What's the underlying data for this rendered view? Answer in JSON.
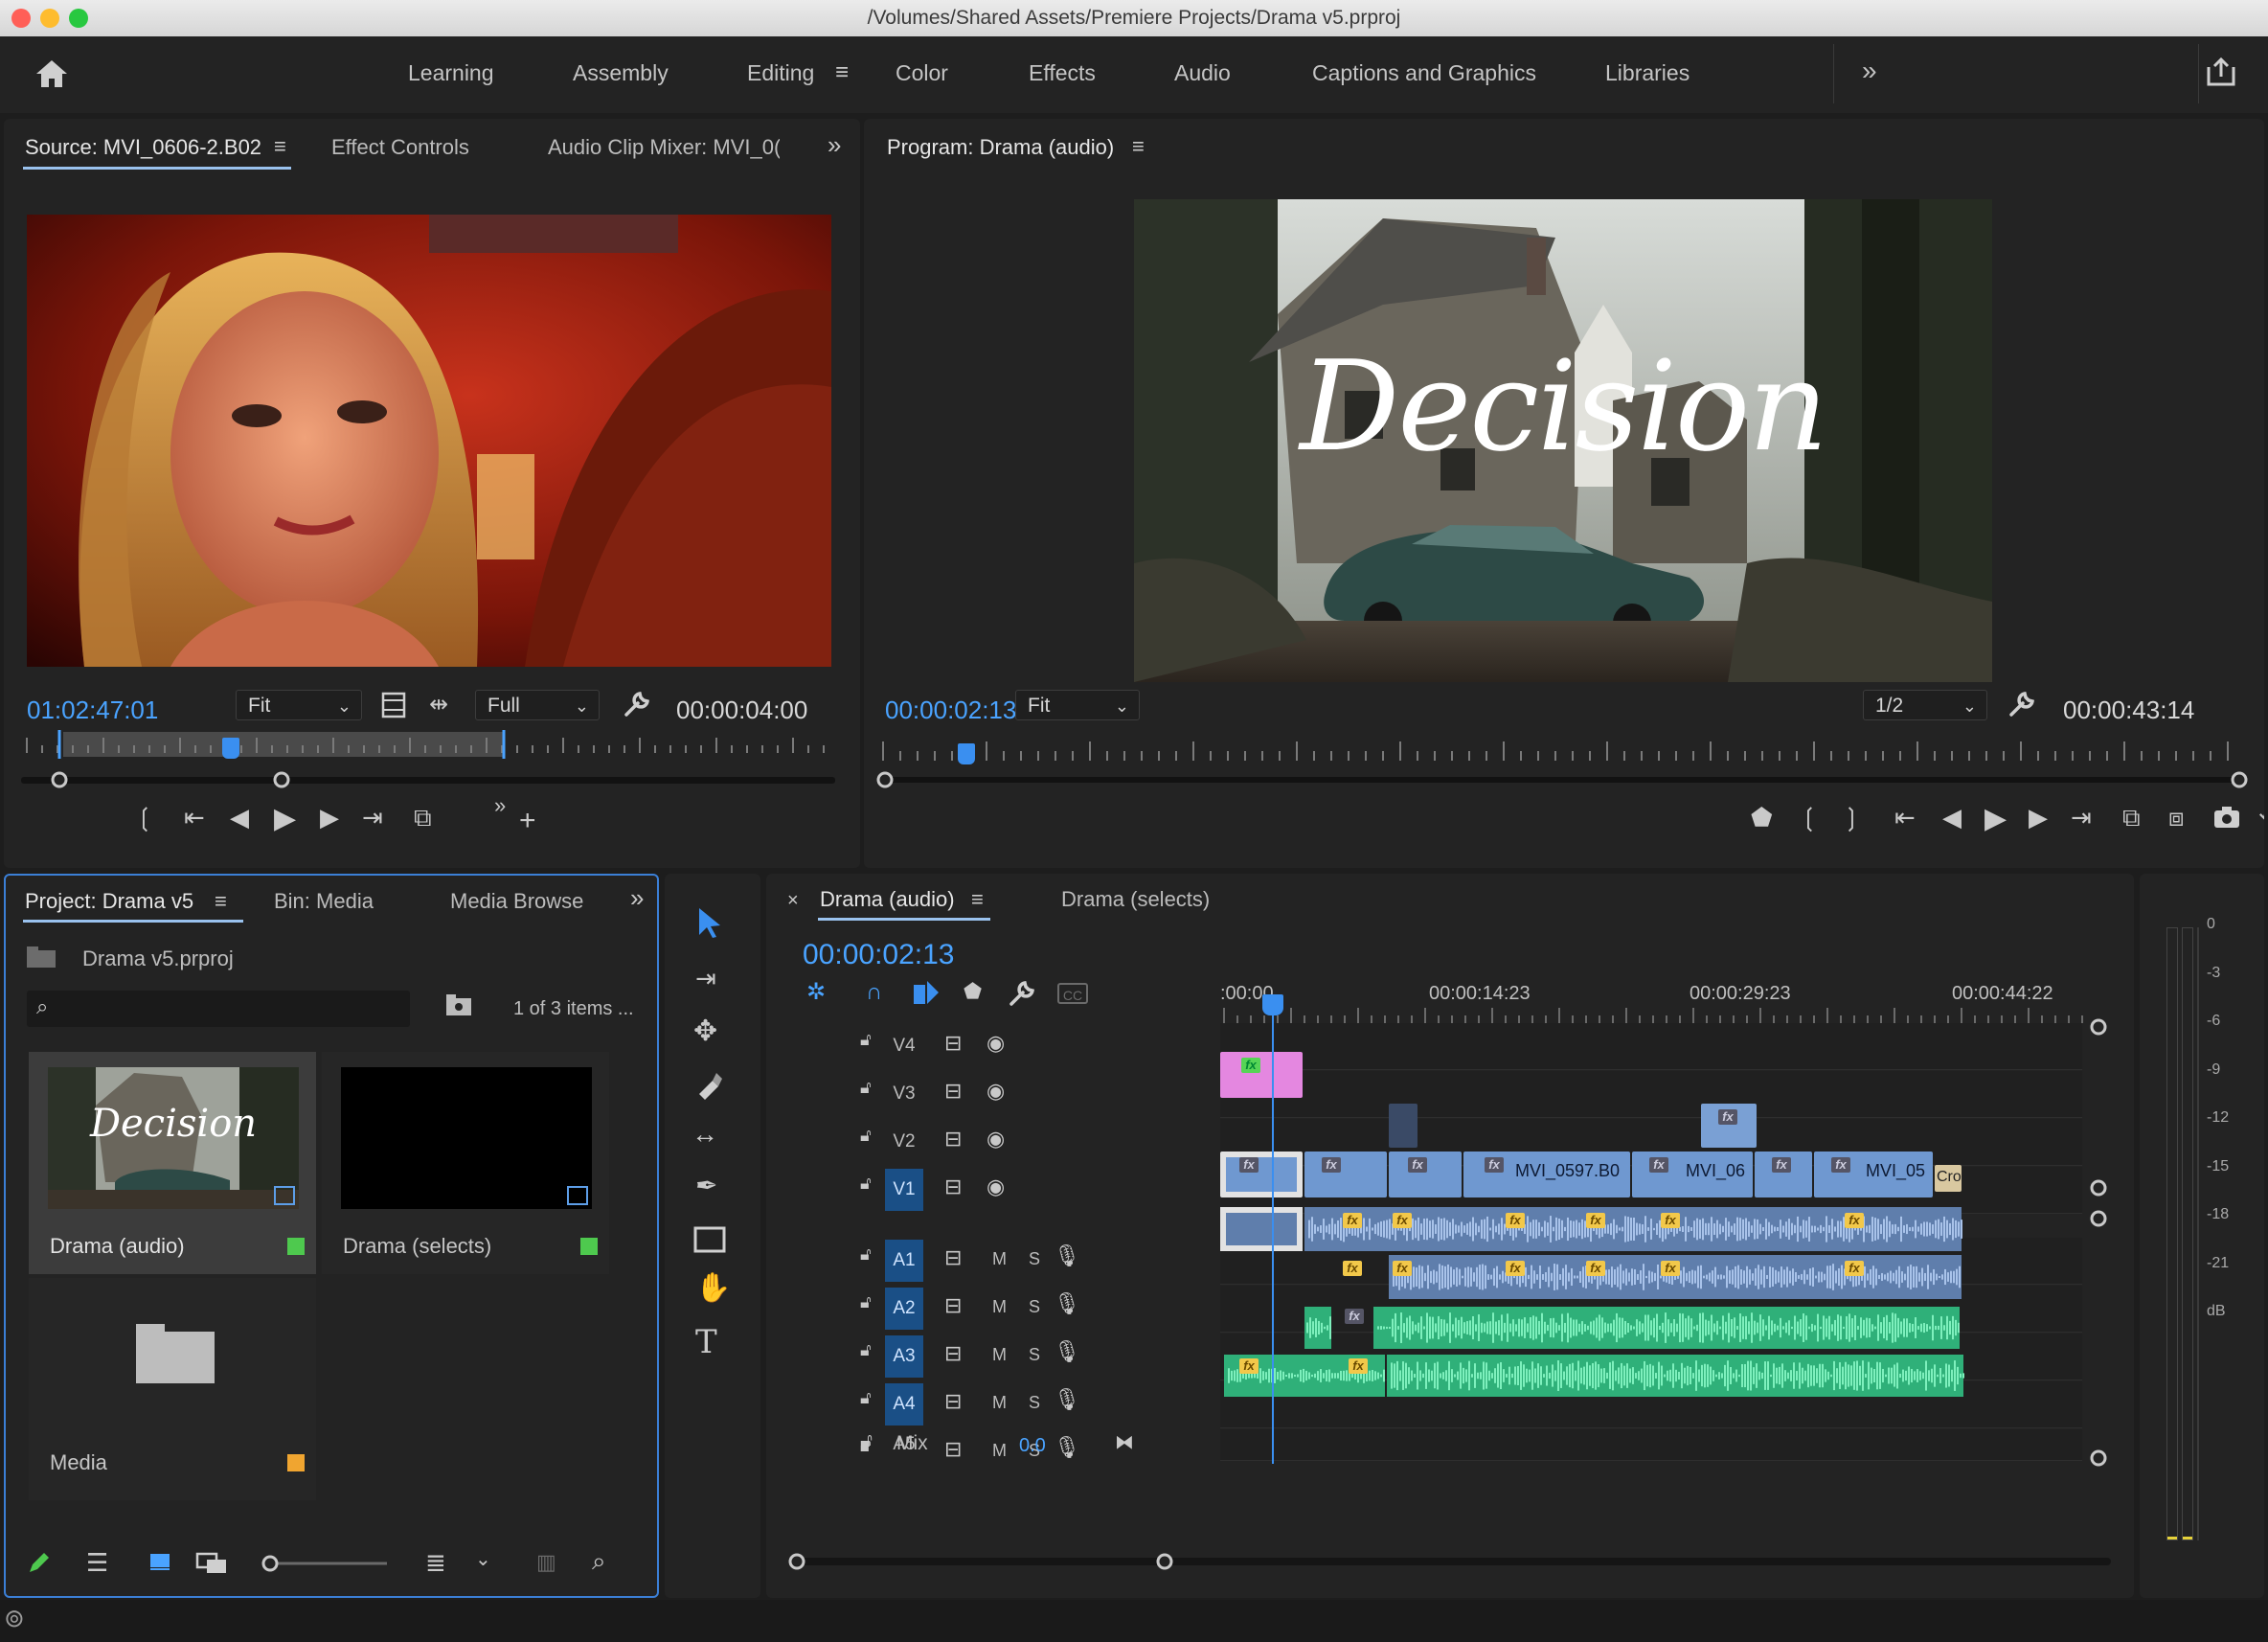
{
  "window": {
    "title": "/Volumes/Shared Assets/Premiere Projects/Drama v5.prproj"
  },
  "workspaces": {
    "items": [
      "Learning",
      "Assembly",
      "Editing",
      "Color",
      "Effects",
      "Audio",
      "Captions and Graphics",
      "Libraries"
    ],
    "active": "Editing",
    "overflow": "»"
  },
  "source_panel": {
    "tabs": [
      "Source: MVI_0606-2.B02",
      "Effect Controls",
      "Audio Clip Mixer: MVI_0("
    ],
    "timecode": "01:02:47:01",
    "zoom": "Fit",
    "resolution": "Full",
    "duration": "00:00:04:00",
    "playhead_fraction": 0.38
  },
  "program_panel": {
    "title": "Program: Drama (audio)",
    "timecode": "00:00:02:13",
    "zoom": "Fit",
    "resolution": "1/2",
    "duration": "00:00:43:14",
    "title_overlay": "Decision",
    "playhead_fraction": 0.06
  },
  "project_panel": {
    "tabs": [
      "Project: Drama v5",
      "Bin: Media",
      "Media Browse"
    ],
    "file": "Drama v5.prproj",
    "count": "1 of 3 items ...",
    "items": [
      {
        "name": "Drama (audio)",
        "color": "#4ec94e",
        "thumb_text": "Decision"
      },
      {
        "name": "Drama (selects)",
        "color": "#4ec94e"
      },
      {
        "name": "Media",
        "color": "#f0a530"
      }
    ]
  },
  "timeline": {
    "tabs": [
      "Drama (audio)",
      "Drama (selects)"
    ],
    "timecode": "00:00:02:13",
    "ruler": [
      ":00:00",
      "00:00:14:23",
      "00:00:29:23",
      "00:00:44:22"
    ],
    "video_tracks": [
      "V4",
      "V3",
      "V2",
      "V1"
    ],
    "audio_tracks": [
      "A1",
      "A2",
      "A3",
      "A4",
      "A5"
    ],
    "mute_label": "M",
    "solo_label": "S",
    "mix_label": "Mix",
    "mix_value": "0.0",
    "clips": {
      "v1_a": "MVI_0597.B0",
      "v1_b": "MVI_06",
      "v1_c": "MVI_05",
      "v1_d": "Cro"
    },
    "fx_label": "fx"
  },
  "meters": {
    "labels": [
      "0",
      "-3",
      "-6",
      "-9",
      "-12",
      "-15",
      "-18",
      "-21",
      "dB"
    ]
  },
  "colors": {
    "accent": "#4aa3ff",
    "video_clip": "#6f98d0",
    "audio_clip": "#3ecf8e",
    "graphic": "#e77fe0"
  }
}
